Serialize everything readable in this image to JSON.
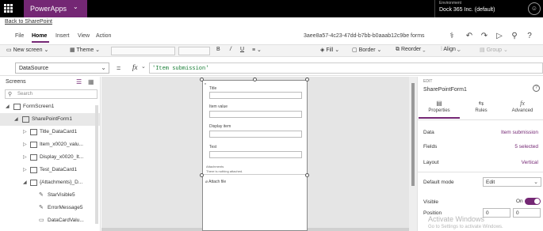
{
  "app": {
    "name": "PowerApps",
    "back_link": "Back to SharePoint",
    "environment_label": "Environment",
    "environment_name": "Dock 365 Inc. (default)",
    "app_id": "3aee8a57-4c23-47dd-b7bb-b0aaab12c9be forms",
    "accent_color": "#742774"
  },
  "ribbon": {
    "tabs": [
      {
        "label": "File"
      },
      {
        "label": "Home",
        "active": true
      },
      {
        "label": "Insert"
      },
      {
        "label": "View"
      },
      {
        "label": "Action"
      }
    ],
    "icons": [
      "stethoscope-icon",
      "undo-icon",
      "redo-icon",
      "play-icon",
      "person-icon",
      "help-icon"
    ]
  },
  "toolbar": {
    "new_screen": "New screen",
    "theme": "Theme",
    "fill": "Fill",
    "border": "Border",
    "reorder": "Reorder",
    "align": "Align",
    "group": "Group"
  },
  "formula": {
    "property": "DataSource",
    "fx": "fx",
    "value": "'Item submission'"
  },
  "left_panel": {
    "title": "Screens",
    "search_placeholder": "Search",
    "tree": [
      {
        "label": "FormScreen1"
      },
      {
        "label": "SharePointForm1",
        "selected": true
      },
      {
        "label": "Title_DataCard1"
      },
      {
        "label": "Item_x0020_valu..."
      },
      {
        "label": "Display_x0020_It..."
      },
      {
        "label": "Test_DataCard1"
      },
      {
        "label": "{Attachments}_D..."
      },
      {
        "label": "StarVisible5"
      },
      {
        "label": "ErrorMessage5"
      },
      {
        "label": "DataCardValu..."
      }
    ]
  },
  "form": {
    "fields": [
      {
        "label": "Title"
      },
      {
        "label": "Item value"
      },
      {
        "label": "Display item"
      },
      {
        "label": "Test"
      }
    ],
    "attachments_label": "Attachments",
    "attachments_empty": "There is nothing attached.",
    "attach_file": "Attach file"
  },
  "right_panel": {
    "control_type": "EDIT",
    "control_name": "SharePointForm1",
    "tabs": [
      {
        "label": "Properties",
        "active": true
      },
      {
        "label": "Rules"
      },
      {
        "label": "Advanced"
      }
    ],
    "rows": {
      "data_label": "Data",
      "data_value": "Item submission",
      "fields_label": "Fields",
      "fields_value": "5 selected",
      "layout_label": "Layout",
      "layout_value": "Vertical",
      "default_mode_label": "Default mode",
      "default_mode_value": "Edit",
      "visible_label": "Visible",
      "visible_value": "On",
      "position_label": "Position",
      "position_x": "0",
      "position_y": "0"
    }
  },
  "watermark": {
    "title": "Activate Windows",
    "subtitle": "Go to Settings to activate Windows."
  }
}
